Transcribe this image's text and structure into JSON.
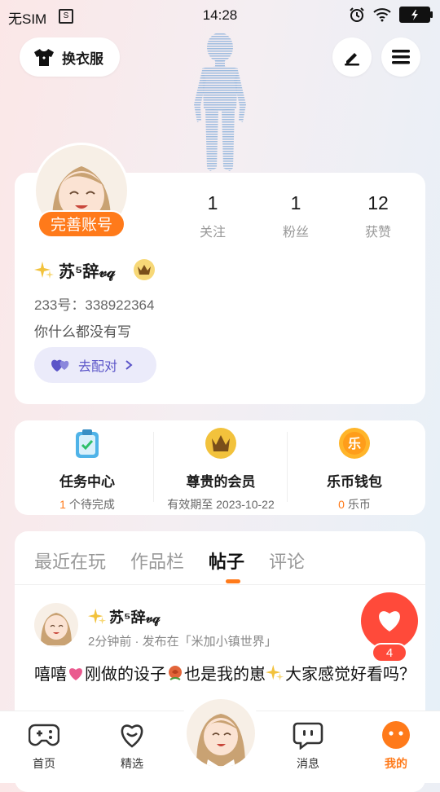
{
  "status_bar": {
    "carrier": "无SIM",
    "sim_icon": "S",
    "time": "14:28"
  },
  "header": {
    "outfit_label": "换衣服"
  },
  "profile": {
    "complete_label": "完善账号",
    "stats": [
      {
        "num": "1",
        "label": "关注"
      },
      {
        "num": "1",
        "label": "粉丝"
      },
      {
        "num": "12",
        "label": "获赞"
      }
    ],
    "username": "苏⁵辞𝓋𝓆",
    "uid": "233号：338922364",
    "bio": "你什么都没有写",
    "pair_label": "去配对"
  },
  "features": {
    "task": {
      "title": "任务中心",
      "count": "1",
      "sub": "个待完成"
    },
    "vip": {
      "title": "尊贵的会员",
      "sub": "有效期至  2023-10-22"
    },
    "wallet": {
      "title": "乐币钱包",
      "count": "0",
      "sub": "乐币",
      "coin_char": "乐"
    }
  },
  "feed": {
    "tabs": [
      "最近在玩",
      "作品栏",
      "帖子",
      "评论"
    ],
    "active_tab": "帖子",
    "post": {
      "author": "苏⁵辞𝓋𝓆",
      "meta": "2分钟前 · 发布在「米加小镇世界」",
      "text_parts": [
        "嘻嘻",
        "刚做的设子",
        "也是我的崽",
        "大家感觉好看吗？"
      ],
      "likes": "4"
    }
  },
  "nav": {
    "items": [
      {
        "label": "首页",
        "icon": "gamepad-icon"
      },
      {
        "label": "精选",
        "icon": "heart-outline-icon"
      },
      {
        "label": "消息",
        "icon": "chat-icon"
      },
      {
        "label": "我的",
        "icon": "me-icon"
      }
    ]
  },
  "colors": {
    "accent": "#ff7a1a",
    "like": "#ff4a3a",
    "pair": "#5b55c8"
  }
}
